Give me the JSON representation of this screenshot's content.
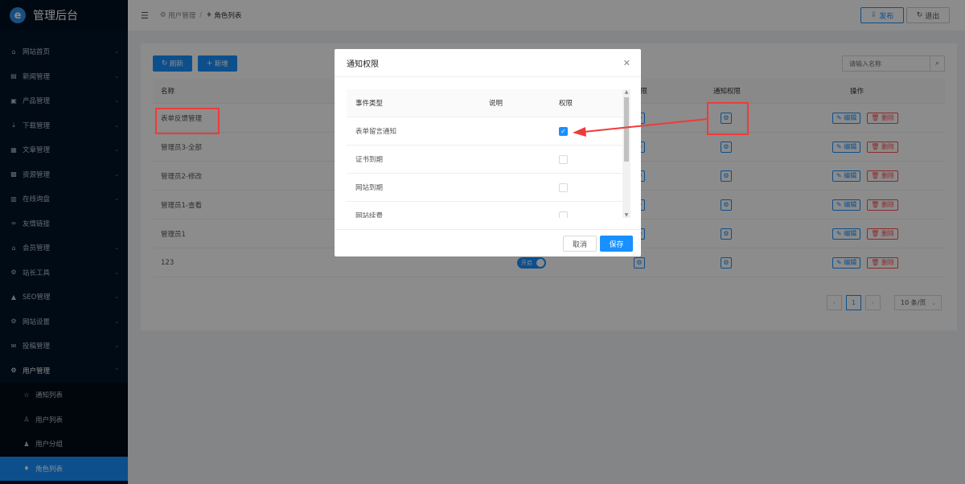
{
  "app": {
    "title": "管理后台",
    "logo_glyph": "e"
  },
  "sidebar": {
    "items": [
      {
        "label": "网站首页",
        "icon": "home-icon"
      },
      {
        "label": "新闻管理",
        "icon": "news-icon"
      },
      {
        "label": "产品管理",
        "icon": "product-icon"
      },
      {
        "label": "下载管理",
        "icon": "download-icon"
      },
      {
        "label": "文章管理",
        "icon": "article-icon"
      },
      {
        "label": "资源管理",
        "icon": "resource-icon"
      },
      {
        "label": "在线询盘",
        "icon": "inquiry-icon"
      },
      {
        "label": "友情链接",
        "icon": "link-icon"
      },
      {
        "label": "会员管理",
        "icon": "member-icon"
      },
      {
        "label": "站长工具",
        "icon": "tools-icon"
      },
      {
        "label": "SEO管理",
        "icon": "seo-icon"
      },
      {
        "label": "网站设置",
        "icon": "settings-icon"
      },
      {
        "label": "投稿管理",
        "icon": "mail-icon"
      },
      {
        "label": "用户管理",
        "icon": "gear-icon"
      }
    ],
    "sub_items": [
      {
        "label": "通知列表",
        "icon": "star-icon"
      },
      {
        "label": "用户列表",
        "icon": "user-icon"
      },
      {
        "label": "用户分组",
        "icon": "users-icon"
      },
      {
        "label": "角色列表",
        "icon": "role-icon"
      }
    ]
  },
  "header": {
    "breadcrumb": [
      "用户管理",
      "角色列表"
    ],
    "publish_label": "发布",
    "logout_label": "退出"
  },
  "toolbar": {
    "refresh_label": "刷新",
    "add_label": "新增"
  },
  "search": {
    "placeholder": "请输入名称"
  },
  "table": {
    "headers": {
      "name": "名称",
      "perm": "权限",
      "notify": "通知权限",
      "ops": "操作"
    },
    "rows": [
      {
        "name": "表单反馈管理"
      },
      {
        "name": "管理员3-全部"
      },
      {
        "name": "管理员2-修改"
      },
      {
        "name": "管理员1-查看"
      },
      {
        "name": "管理员1"
      },
      {
        "name": "123",
        "status": "开启"
      }
    ],
    "edit_label": "编辑",
    "delete_label": "删除"
  },
  "pagination": {
    "current": "1",
    "page_size": "10 条/页"
  },
  "modal": {
    "title": "通知权限",
    "headers": {
      "type": "事件类型",
      "desc": "说明",
      "perm": "权限"
    },
    "rows": [
      {
        "type": "表单留言通知",
        "checked": true
      },
      {
        "type": "证书到期",
        "checked": false
      },
      {
        "type": "网站到期",
        "checked": false
      },
      {
        "type": "网站续费",
        "checked": false
      }
    ],
    "cancel_label": "取消",
    "save_label": "保存"
  },
  "colors": {
    "primary": "#1890ff",
    "danger": "#ff4d4f",
    "sidebar_bg": "#001529",
    "annotation": "#f03a3a"
  }
}
